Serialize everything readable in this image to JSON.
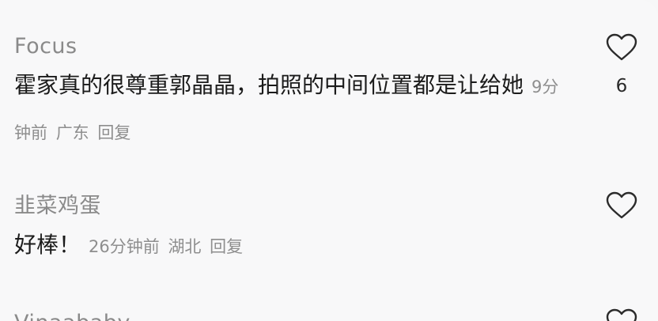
{
  "comments": [
    {
      "username": "Focus",
      "text": "霍家真的很尊重郭晶晶，拍照的中间位置都是让给她",
      "time": "9分钟前",
      "location": "广东",
      "reply_label": "回复",
      "likes": "6"
    },
    {
      "username": "韭菜鸡蛋",
      "text": "好棒！",
      "time": "26分钟前",
      "location": "湖北",
      "reply_label": "回复",
      "likes": ""
    },
    {
      "username": "Vinaababy"
    }
  ],
  "icons": {
    "like": "heart-outline-icon"
  },
  "colors": {
    "background": "#f8f8f9",
    "text": "#1b1b1b",
    "muted": "#8e8e8e"
  }
}
